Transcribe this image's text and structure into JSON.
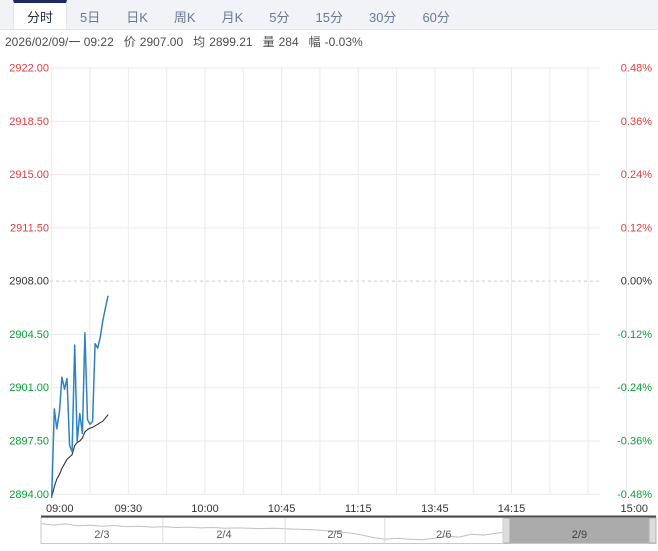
{
  "tabs": {
    "items": [
      {
        "label": "分时",
        "active": true
      },
      {
        "label": "5日",
        "active": false
      },
      {
        "label": "日K",
        "active": false
      },
      {
        "label": "周K",
        "active": false
      },
      {
        "label": "月K",
        "active": false
      },
      {
        "label": "5分",
        "active": false
      },
      {
        "label": "15分",
        "active": false
      },
      {
        "label": "30分",
        "active": false
      },
      {
        "label": "60分",
        "active": false
      }
    ]
  },
  "info": {
    "datetime": "2026/02/09/一 09:22",
    "price_label": "价",
    "price": "2907.00",
    "avg_label": "均",
    "avg": "2899.21",
    "vol_label": "量",
    "vol": "284",
    "chg_label": "幅",
    "chg": "-0.03%"
  },
  "colors": {
    "up": "#e53c3c",
    "down": "#0aa136",
    "neutral": "#333333",
    "price_line": "#2e81c4",
    "avg_line": "#333333",
    "grid": "#eaeaea",
    "grid_zero": "#cccccc",
    "x_label": "#333333",
    "tab_active_border": "#1c2a60",
    "nav_border_top": "#4a4a4a",
    "nav_border": "#c9c9c9",
    "nav_separator": "#dddddd",
    "nav_spark": "#c0c0c0",
    "nav_selection": "#ababab",
    "nav_handle": "#dcdcdc",
    "nav_handle_border": "#b0b0b0",
    "nav_date": "#5a5a5a",
    "nav_date_selected": "#3f3f3f"
  },
  "chart_data": {
    "type": "line",
    "title": "intraday time-share chart",
    "base_price": 2908.0,
    "ylim": [
      2894.0,
      2922.0
    ],
    "session_minutes": 225,
    "minor_grid_minutes": 15,
    "current_minute": 22,
    "y_axis_left": [
      {
        "text": "2922.00",
        "value": 2922.0,
        "tone": "up"
      },
      {
        "text": "2918.50",
        "value": 2918.5,
        "tone": "up"
      },
      {
        "text": "2915.00",
        "value": 2915.0,
        "tone": "up"
      },
      {
        "text": "2911.50",
        "value": 2911.5,
        "tone": "up"
      },
      {
        "text": "2908.00",
        "value": 2908.0,
        "tone": "neutral"
      },
      {
        "text": "2904.50",
        "value": 2904.5,
        "tone": "down"
      },
      {
        "text": "2901.00",
        "value": 2901.0,
        "tone": "down"
      },
      {
        "text": "2897.50",
        "value": 2897.5,
        "tone": "down"
      },
      {
        "text": "2894.00",
        "value": 2894.0,
        "tone": "down"
      }
    ],
    "y_axis_right": [
      {
        "text": "0.48%",
        "tone": "up"
      },
      {
        "text": "0.36%",
        "tone": "up"
      },
      {
        "text": "0.24%",
        "tone": "up"
      },
      {
        "text": "0.12%",
        "tone": "up"
      },
      {
        "text": "0.00%",
        "tone": "neutral"
      },
      {
        "text": "-0.12%",
        "tone": "down"
      },
      {
        "text": "-0.24%",
        "tone": "down"
      },
      {
        "text": "-0.36%",
        "tone": "down"
      },
      {
        "text": "-0.48%",
        "tone": "down"
      }
    ],
    "x_axis": {
      "labels": [
        {
          "text": "09:00",
          "min": 0
        },
        {
          "text": "09:30",
          "min": 30
        },
        {
          "text": "10:00",
          "min": 60
        },
        {
          "text": "10:45",
          "min": 90
        },
        {
          "text": "11:15",
          "min": 120
        },
        {
          "text": "13:45",
          "min": 150
        },
        {
          "text": "14:15",
          "min": 180
        },
        {
          "text": "15:00",
          "min": 225
        }
      ]
    },
    "series": [
      {
        "name": "price",
        "x_min": [
          0,
          1,
          2,
          3,
          4,
          5,
          6,
          7,
          8,
          9,
          10,
          11,
          12,
          13,
          14,
          15,
          16,
          17,
          18,
          19,
          20,
          21,
          22
        ],
        "values": [
          2893.8,
          2899.6,
          2898.3,
          2899.4,
          2901.7,
          2900.9,
          2901.6,
          2897.2,
          2896.8,
          2903.8,
          2897.5,
          2899.3,
          2898.0,
          2904.6,
          2898.9,
          2898.6,
          2898.8,
          2903.9,
          2903.6,
          2904.3,
          2905.4,
          2906.2,
          2907.0
        ]
      },
      {
        "name": "average",
        "x_min": [
          0,
          1,
          2,
          3,
          4,
          5,
          6,
          7,
          8,
          9,
          10,
          11,
          12,
          13,
          14,
          15,
          16,
          17,
          18,
          19,
          20,
          21,
          22
        ],
        "values": [
          2893.8,
          2894.5,
          2895.0,
          2895.3,
          2895.7,
          2896.0,
          2896.3,
          2896.45,
          2896.6,
          2897.2,
          2897.4,
          2897.5,
          2897.7,
          2898.1,
          2898.25,
          2898.35,
          2898.4,
          2898.5,
          2898.6,
          2898.7,
          2898.8,
          2899.0,
          2899.21
        ]
      }
    ],
    "navigator": {
      "dates": [
        "2/3",
        "2/4",
        "2/5",
        "2/6",
        "2/9"
      ],
      "selected": "2/9",
      "spark": [
        [
          0.0,
          0.15
        ],
        [
          0.02,
          0.23
        ],
        [
          0.04,
          0.17
        ],
        [
          0.06,
          0.27
        ],
        [
          0.08,
          0.23
        ],
        [
          0.1,
          0.29
        ],
        [
          0.12,
          0.25
        ],
        [
          0.14,
          0.31
        ],
        [
          0.16,
          0.29
        ],
        [
          0.18,
          0.33
        ],
        [
          0.2,
          0.31
        ],
        [
          0.22,
          0.35
        ],
        [
          0.24,
          0.33
        ],
        [
          0.26,
          0.37
        ],
        [
          0.28,
          0.35
        ],
        [
          0.3,
          0.39
        ],
        [
          0.32,
          0.37
        ],
        [
          0.34,
          0.39
        ],
        [
          0.36,
          0.4
        ],
        [
          0.38,
          0.39
        ],
        [
          0.4,
          0.42
        ],
        [
          0.42,
          0.44
        ],
        [
          0.44,
          0.46
        ],
        [
          0.46,
          0.5
        ],
        [
          0.48,
          0.56
        ],
        [
          0.5,
          0.62
        ],
        [
          0.52,
          0.71
        ],
        [
          0.54,
          0.85
        ],
        [
          0.56,
          0.94
        ],
        [
          0.58,
          0.89
        ],
        [
          0.6,
          0.94
        ],
        [
          0.62,
          0.96
        ],
        [
          0.64,
          0.89
        ],
        [
          0.66,
          0.77
        ],
        [
          0.68,
          0.83
        ],
        [
          0.7,
          0.69
        ],
        [
          0.72,
          0.73
        ],
        [
          0.74,
          0.64
        ],
        [
          0.75,
          0.6
        ]
      ]
    }
  }
}
